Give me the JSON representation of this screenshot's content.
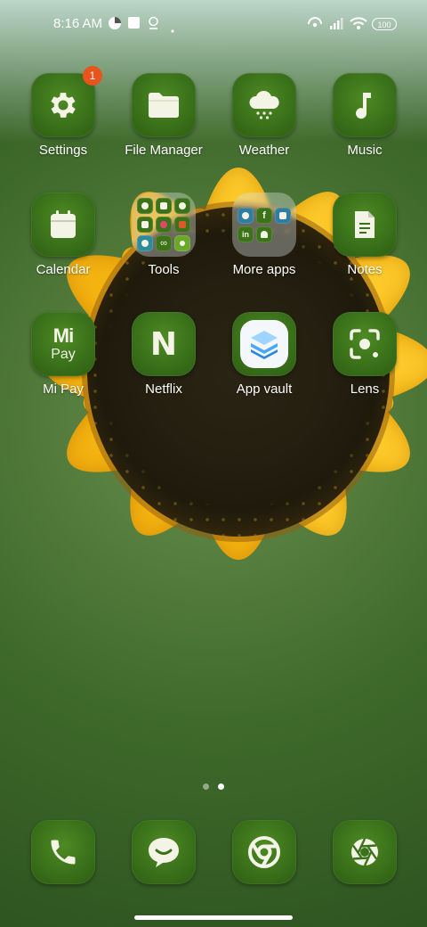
{
  "status_bar": {
    "time": "8:16 AM",
    "battery": "100"
  },
  "apps": [
    {
      "label": "Settings",
      "icon": "gear-icon",
      "badge": "1"
    },
    {
      "label": "File Manager",
      "icon": "folder-icon"
    },
    {
      "label": "Weather",
      "icon": "weather-cloud-icon"
    },
    {
      "label": "Music",
      "icon": "music-note-icon"
    },
    {
      "label": "Calendar",
      "icon": "calendar-icon"
    },
    {
      "label": "Tools",
      "icon": "folder-tools"
    },
    {
      "label": "More apps",
      "icon": "folder-more-apps"
    },
    {
      "label": "Notes",
      "icon": "notes-icon"
    },
    {
      "label": "Mi Pay",
      "icon": "mi-pay-icon",
      "icon_text_top": "Mi",
      "icon_text_bottom": "Pay"
    },
    {
      "label": "Netflix",
      "icon": "netflix-icon",
      "icon_text": "N"
    },
    {
      "label": "App vault",
      "icon": "app-vault-icon"
    },
    {
      "label": "Lens",
      "icon": "lens-icon"
    }
  ],
  "dock": [
    {
      "icon": "phone-icon"
    },
    {
      "icon": "messages-icon"
    },
    {
      "icon": "chrome-icon"
    },
    {
      "icon": "camera-shutter-icon"
    }
  ],
  "page_indicator": {
    "count": 2,
    "active": 2
  },
  "colors": {
    "icon_green": "#3a711a",
    "badge": "#e8541c",
    "petal": "#f7b812"
  }
}
